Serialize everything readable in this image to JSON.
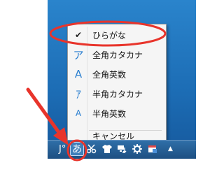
{
  "menu": {
    "items": [
      {
        "glyph": "✔",
        "label": "ひらがな",
        "icon": "checkmark-icon"
      },
      {
        "glyph": "ア",
        "label": "全角カタカナ",
        "icon": "fullwidth-katakana-icon"
      },
      {
        "glyph": "A",
        "label": "全角英数",
        "icon": "fullwidth-alphanumeric-icon"
      },
      {
        "glyph": "ｱ",
        "label": "半角カタカナ",
        "icon": "halfwidth-katakana-icon"
      },
      {
        "glyph": "A",
        "label": "半角英数",
        "icon": "halfwidth-alphanumeric-icon"
      },
      {
        "glyph": "",
        "label": "キャンセル",
        "icon": ""
      }
    ]
  },
  "taskbar": {
    "ime_prefix": "J°",
    "ime_current": "あ",
    "tray_icons": [
      "scissors-icon",
      "shirt-icon",
      "network-icon",
      "gear-icon",
      "window-icon",
      "up-arrow-icon"
    ]
  },
  "annotation_colors": {
    "highlight": "#e8342b"
  }
}
